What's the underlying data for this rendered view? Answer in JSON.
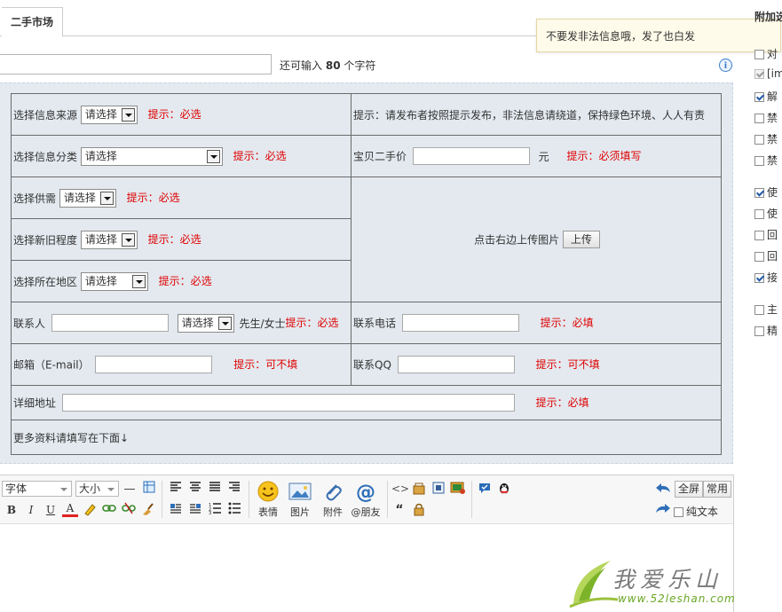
{
  "tabs": {
    "active": "二手市场"
  },
  "title_row": {
    "value": "",
    "counter_prefix": "还可输入",
    "counter_value": "80",
    "counter_suffix": "个字符"
  },
  "tooltip": {
    "text": "不要发非法信息哦，发了也白发"
  },
  "right_panel": {
    "title": "附加选",
    "options": [
      {
        "label": "对",
        "checked": false,
        "disabled": false
      },
      {
        "label": "[im",
        "checked": true,
        "disabled": true
      },
      {
        "label": "解",
        "checked": true,
        "disabled": false
      },
      {
        "label": "禁",
        "checked": false,
        "disabled": false
      },
      {
        "label": "禁",
        "checked": false,
        "disabled": false
      },
      {
        "label": "禁",
        "checked": false,
        "disabled": false
      },
      {
        "label": "使",
        "checked": true,
        "disabled": false
      },
      {
        "label": "使",
        "checked": false,
        "disabled": false
      },
      {
        "label": "回",
        "checked": false,
        "disabled": false
      },
      {
        "label": "回",
        "checked": false,
        "disabled": false
      },
      {
        "label": "接",
        "checked": true,
        "disabled": false
      },
      {
        "label": "主",
        "checked": false,
        "disabled": false
      },
      {
        "label": "精",
        "checked": false,
        "disabled": false
      }
    ]
  },
  "form": {
    "source": {
      "label": "选择信息来源",
      "select": "请选择",
      "hint": "提示：必选"
    },
    "top_notice": "提示：请发布者按照提示发布，非法信息请绕道，保持绿色环境、人人有责",
    "category": {
      "label": "选择信息分类",
      "select": "请选择",
      "hint": "提示：必选"
    },
    "price": {
      "label": "宝贝二手价",
      "value": "",
      "unit": "元",
      "hint": "提示：必须填写"
    },
    "supply": {
      "label": "选择供需",
      "select": "请选择",
      "hint": "提示：必选"
    },
    "condition": {
      "label": "选择新旧程度",
      "select": "请选择",
      "hint": "提示：必选"
    },
    "upload": {
      "label": "点击右边上传图片",
      "button": "上传"
    },
    "region": {
      "label": "选择所在地区",
      "select": "请选择",
      "hint": "提示：必选"
    },
    "contact": {
      "label": "联系人",
      "value": "",
      "select": "请选择",
      "suffix": "先生/女士",
      "hint": "提示：必选"
    },
    "phone": {
      "label": "联系电话",
      "value": "",
      "hint": "提示：必填"
    },
    "email": {
      "label": "邮箱（E-mail）",
      "value": "",
      "hint": "提示：可不填"
    },
    "qq": {
      "label": "联系QQ",
      "value": "",
      "hint": "提示：可不填"
    },
    "address": {
      "label": "详细地址",
      "value": "",
      "hint": "提示：必填"
    },
    "more_note": "更多资料请填写在下面↓"
  },
  "editor": {
    "font_select": "字体",
    "size_select": "大小",
    "format_icons": [
      "hr-icon",
      "table-icon",
      "align-left-icon",
      "align-center-icon",
      "align-justify-icon",
      "align-right-icon",
      "bold-icon",
      "italic-icon",
      "underline-icon",
      "font-color-icon",
      "highlight-icon",
      "link-icon",
      "unlink-icon",
      "clear-format-icon",
      "float-left-icon",
      "float-right-icon",
      "ordered-list-icon",
      "unordered-list-icon"
    ],
    "big_buttons": {
      "emoji": "表情",
      "image": "图片",
      "attach": "附件",
      "friend": "@朋友"
    },
    "right_buttons": {
      "fullscreen": "全屏",
      "common": "常用",
      "plaintext": "纯文本"
    },
    "plaintext_checked": false
  },
  "watermark": {
    "text": "我爱乐山",
    "url": "www.52leshan.com"
  }
}
